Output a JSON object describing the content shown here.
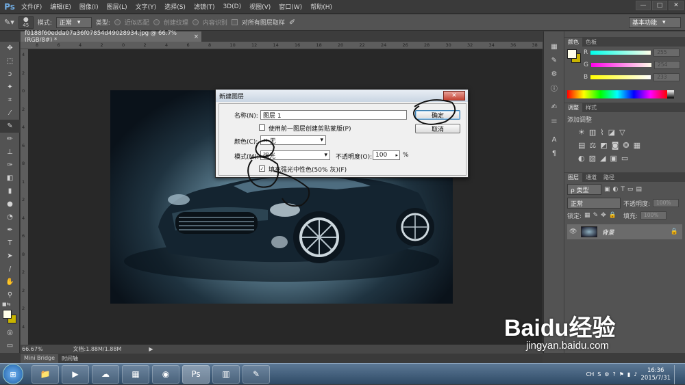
{
  "app": {
    "logo": "Ps",
    "menus": [
      "文件(F)",
      "编辑(E)",
      "图像(I)",
      "图层(L)",
      "文字(Y)",
      "选择(S)",
      "滤镜(T)",
      "3D(D)",
      "视图(V)",
      "窗口(W)",
      "帮助(H)"
    ],
    "window_buttons": [
      "—",
      "□",
      "✕"
    ]
  },
  "options": {
    "brush_size": "45",
    "mode_label": "模式:",
    "mode_value": "正常",
    "type_label": "类型:",
    "radio1": "近似匹配",
    "radio2": "创建纹理",
    "radio3": "内容识别",
    "sample_all": "对所有图层取样",
    "workspace": "基本功能"
  },
  "document": {
    "tab_title": "f0188f60edda07a36f07854d49028934.jpg @ 66.7%(RGB/8#) *",
    "ruler_h": [
      "8",
      "6",
      "4",
      "2",
      "0",
      "2",
      "4",
      "6",
      "8",
      "10",
      "12",
      "14",
      "16",
      "18",
      "20",
      "22",
      "24",
      "26",
      "28",
      "30",
      "32",
      "34",
      "36",
      "38"
    ],
    "ruler_v": [
      "4",
      "2",
      "0",
      "2",
      "4",
      "6",
      "8",
      "1",
      "2",
      "4",
      "6",
      "8",
      "2",
      "2",
      "2",
      "4"
    ]
  },
  "status": {
    "zoom": "66.67%",
    "doc_size": "文档:1.88M/1.88M"
  },
  "bottom_tabs": [
    "Mini Bridge",
    "时间轴"
  ],
  "color_panel": {
    "tabs": [
      "颜色",
      "色板"
    ],
    "r_label": "R",
    "g_label": "G",
    "b_label": "B",
    "r_value": "255",
    "g_value": "254",
    "b_value": "233"
  },
  "adjust_panel": {
    "tabs": [
      "调整",
      "样式"
    ],
    "title": "添加调整"
  },
  "layers_panel": {
    "tabs": [
      "图层",
      "通道",
      "路径"
    ],
    "filter": "ρ 类型",
    "blend": "正常",
    "opacity_label": "不透明度:",
    "opacity_value": "100%",
    "lock_label": "锁定:",
    "fill_label": "填充:",
    "fill_value": "100%",
    "layer_name": "背景"
  },
  "dialog": {
    "title": "新建图层",
    "name_label": "名称(N):",
    "name_value": "图层 1",
    "clip_label": "使用前一图层创建剪贴蒙版(P)",
    "color_label": "颜色(C):",
    "color_value": "无",
    "mode_label": "模式(M):",
    "mode_value": "强光",
    "opacity_label": "不透明度(O):",
    "opacity_value": "100",
    "percent": "%",
    "fill_label": "填充强光中性色(50% 灰)(F)",
    "ok": "确定",
    "cancel": "取消"
  },
  "taskbar": {
    "lang": "CH",
    "time": "16:36",
    "date": "2015/7/31"
  },
  "watermark": {
    "brand": "Baidu经验",
    "url": "jingyan.baidu.com"
  }
}
